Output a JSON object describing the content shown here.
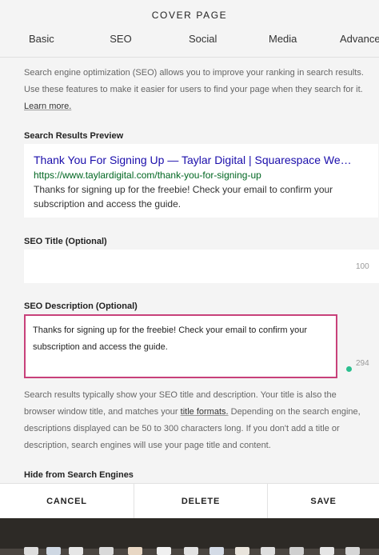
{
  "header": {
    "title": "COVER PAGE",
    "tabs": [
      {
        "label": "Basic"
      },
      {
        "label": "SEO"
      },
      {
        "label": "Social"
      },
      {
        "label": "Media"
      },
      {
        "label": "Advance"
      }
    ]
  },
  "intro": {
    "text": "Search engine optimization (SEO) allows you to improve your ranking in search results. Use these features to make it easier for users to find your page when they search for it.",
    "link": "Learn more."
  },
  "preview": {
    "label": "Search Results Preview",
    "title": "Thank You For Signing Up — Taylar Digital | Squarespace We…",
    "url": "https://www.taylardigital.com/thank-you-for-signing-up",
    "description": "Thanks for signing up for the freebie! Check your email to confirm your subscription and access the guide."
  },
  "seo_title": {
    "label": "SEO Title (Optional)",
    "value": "",
    "counter": "100"
  },
  "seo_description": {
    "label": "SEO Description (Optional)",
    "value": "Thanks for signing up for the freebie! Check your email to confirm your subscription and access the guide.",
    "counter": "294"
  },
  "help": {
    "text_before": "Search results typically show your SEO title and description. Your title is also the browser window title, and matches your",
    "link": "title formats.",
    "text_after": "Depending on the search engine, descriptions displayed can be 50 to 300 characters long. If you don't add a title or description, search engines will use your page title and content."
  },
  "hide": {
    "label": "Hide from Search Engines"
  },
  "footer": {
    "cancel": "CANCEL",
    "delete": "DELETE",
    "save": "SAVE"
  },
  "colors": {
    "accent_border": "#c8417a",
    "status_dot": "#2bbf8f",
    "preview_title": "#1a0dab",
    "preview_url": "#006621"
  }
}
